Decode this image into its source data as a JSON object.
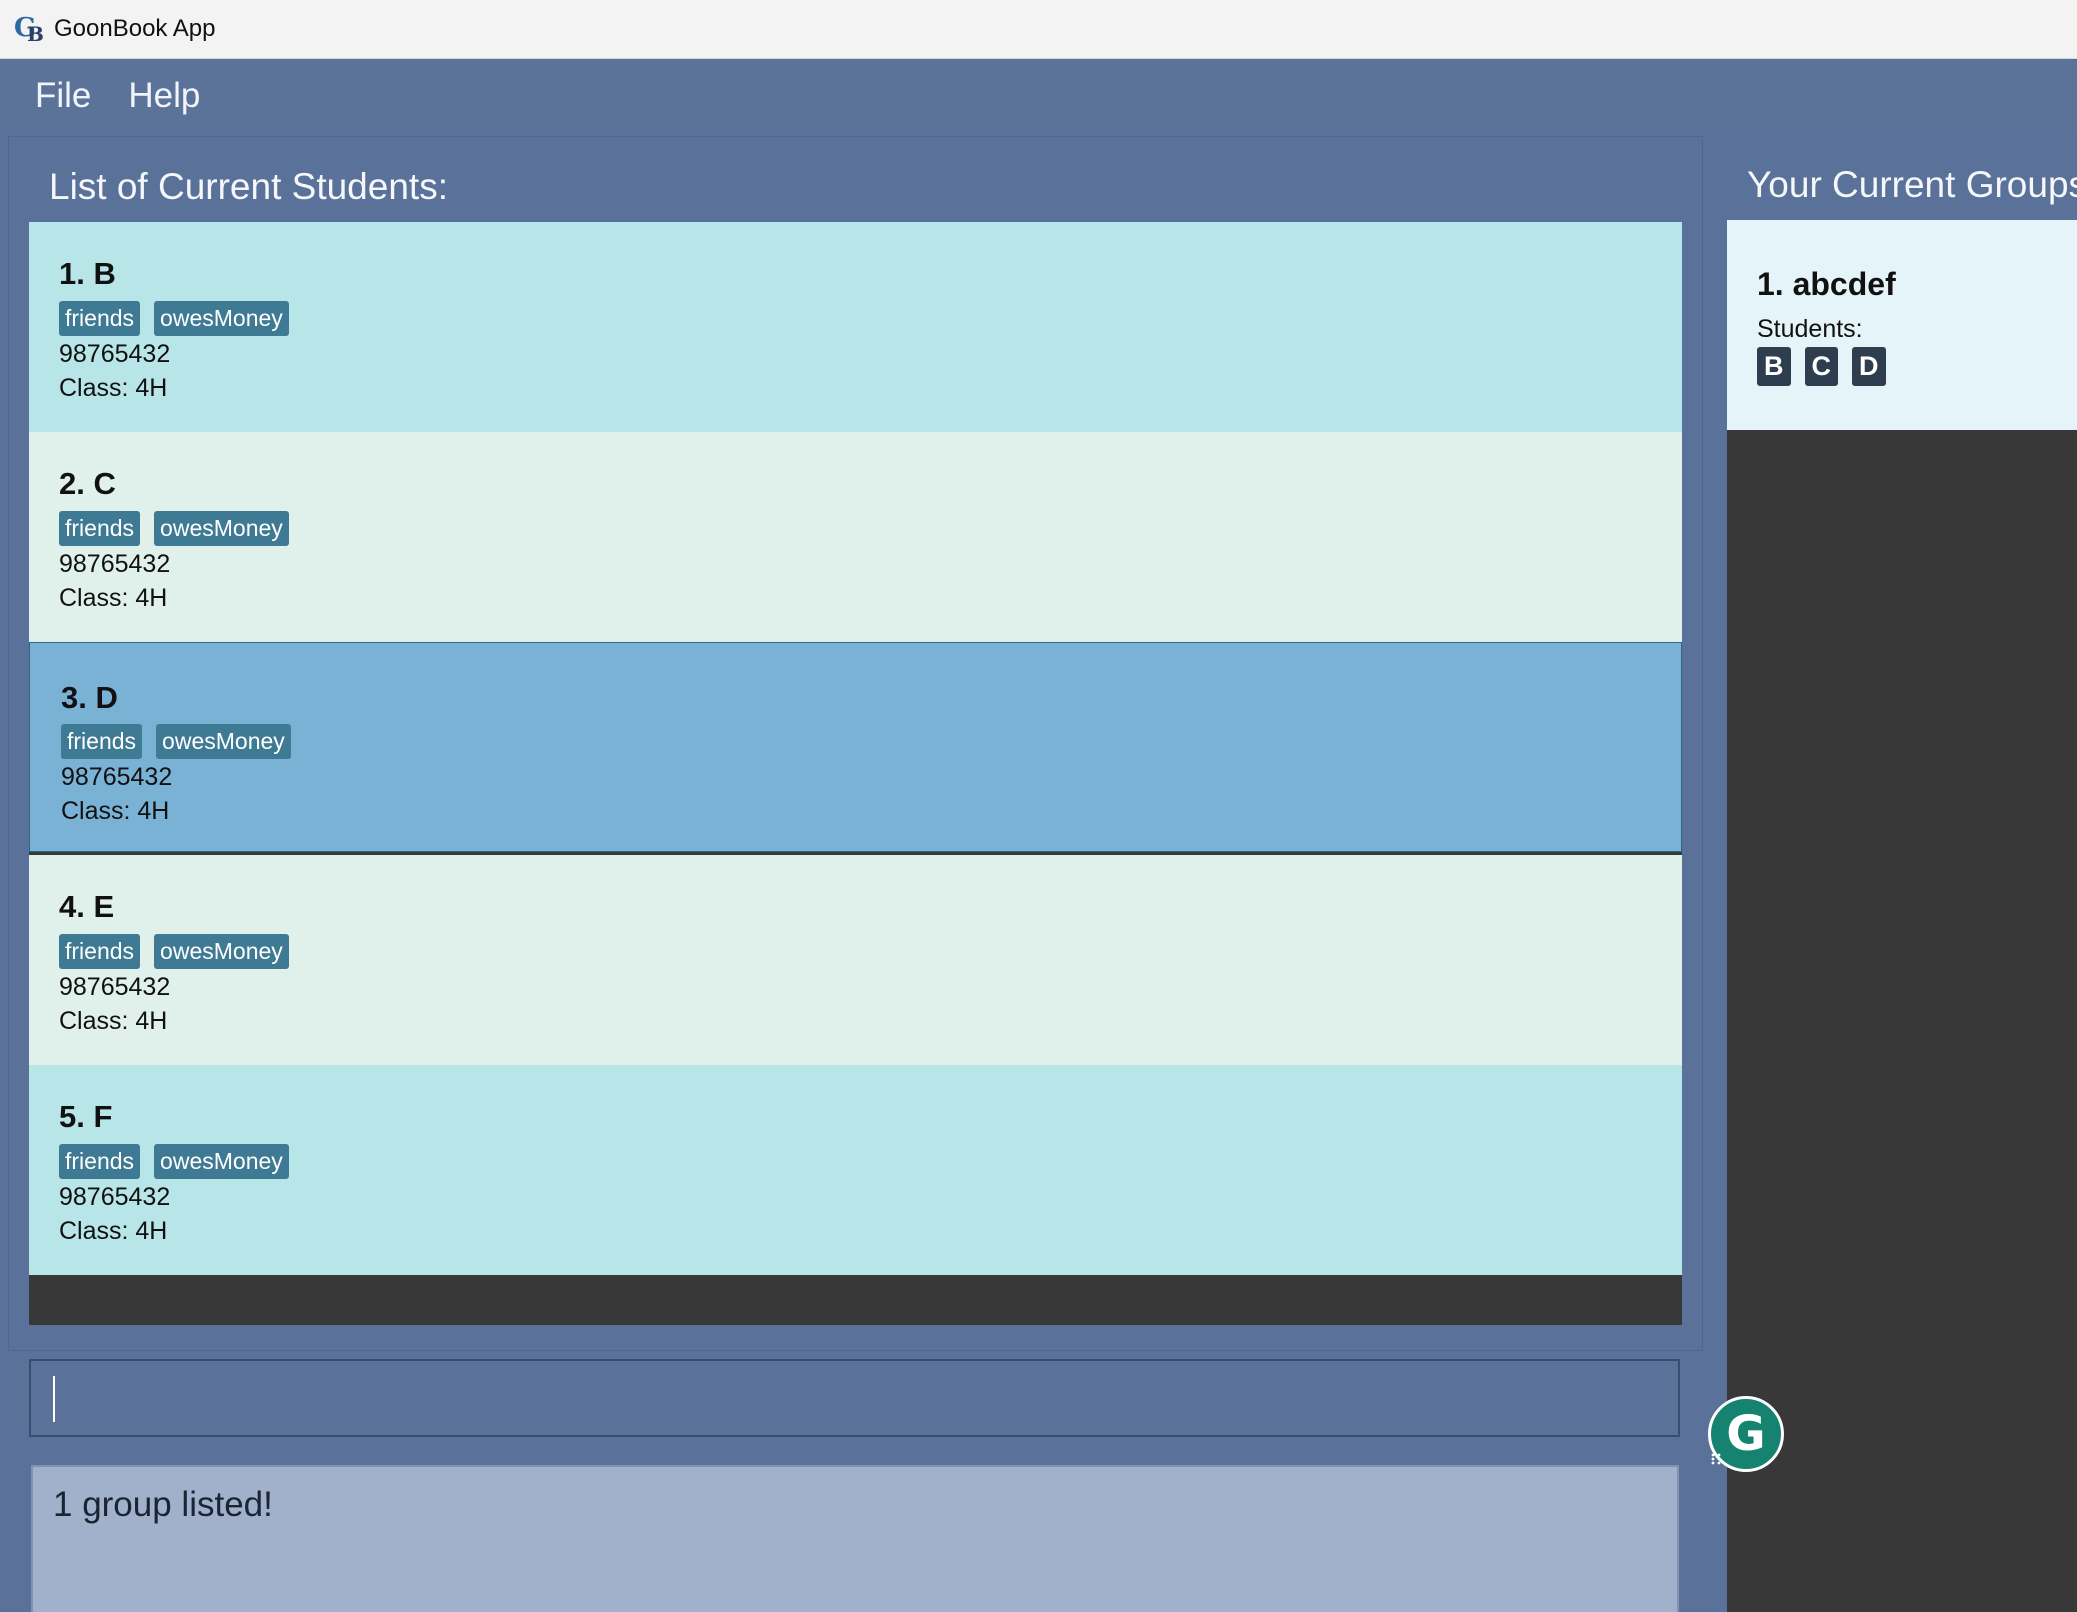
{
  "window": {
    "title": "GoonBook App"
  },
  "menu": {
    "file": "File",
    "help": "Help"
  },
  "students_heading": "List of Current Students:",
  "groups_heading": "Your Current Groups",
  "students": [
    {
      "name": "1. B",
      "tags": [
        "friends",
        "owesMoney"
      ],
      "phone": "98765432",
      "class": "Class: 4H",
      "bg": "#b8e5e8"
    },
    {
      "name": "2. C",
      "tags": [
        "friends",
        "owesMoney"
      ],
      "phone": "98765432",
      "class": "Class: 4H",
      "bg": "#dff1ea"
    },
    {
      "name": "3. D",
      "tags": [
        "friends",
        "owesMoney"
      ],
      "phone": "98765432",
      "class": "Class: 4H",
      "bg": "#7ab2d6",
      "selected": true
    },
    {
      "name": "4. E",
      "tags": [
        "friends",
        "owesMoney"
      ],
      "phone": "98765432",
      "class": "Class: 4H",
      "bg": "#dff1ea"
    },
    {
      "name": "5. F",
      "tags": [
        "friends",
        "owesMoney"
      ],
      "phone": "98765432",
      "class": "Class: 4H",
      "bg": "#b8e5e8"
    }
  ],
  "groups": [
    {
      "name": "1. abcdef",
      "students_label": "Students:",
      "members": [
        "B",
        "C",
        "D"
      ]
    }
  ],
  "command": {
    "value": ""
  },
  "result": {
    "text": "1 group listed!"
  },
  "icons": {
    "app": "goonbook-logo-icon",
    "floating": "grammarly-icon"
  }
}
